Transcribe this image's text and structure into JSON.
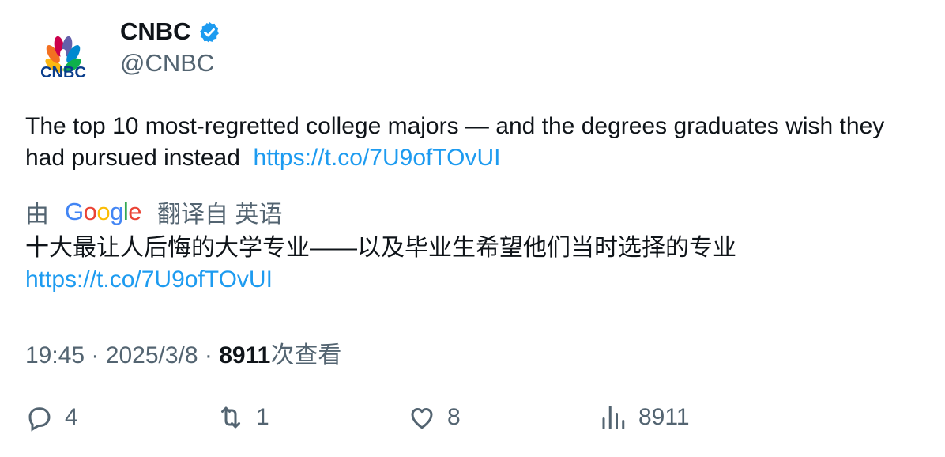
{
  "account": {
    "name": "CNBC",
    "handle": "@CNBC",
    "logo_text": "CNBC"
  },
  "tweet": {
    "text": "The top 10 most-regretted college majors — and the degrees graduates wish they had pursued instead",
    "link": "https://t.co/7U9ofTOvUI"
  },
  "translation": {
    "prefix": "由",
    "provider": "Google",
    "suffix": "翻译自 英语",
    "text": "十大最让人后悔的大学专业——以及毕业生希望他们当时选择的专业",
    "link": "https://t.co/7U9ofTOvUI"
  },
  "meta": {
    "time": "19:45",
    "date": "2025/3/8",
    "views": "8911",
    "views_label": "次查看",
    "separator": "·"
  },
  "actions": {
    "replies": "4",
    "retweets": "1",
    "likes": "8",
    "views": "8911"
  },
  "colors": {
    "link": "#1d9bf0",
    "secondary": "#536471",
    "verified": "#1d9bf0"
  }
}
